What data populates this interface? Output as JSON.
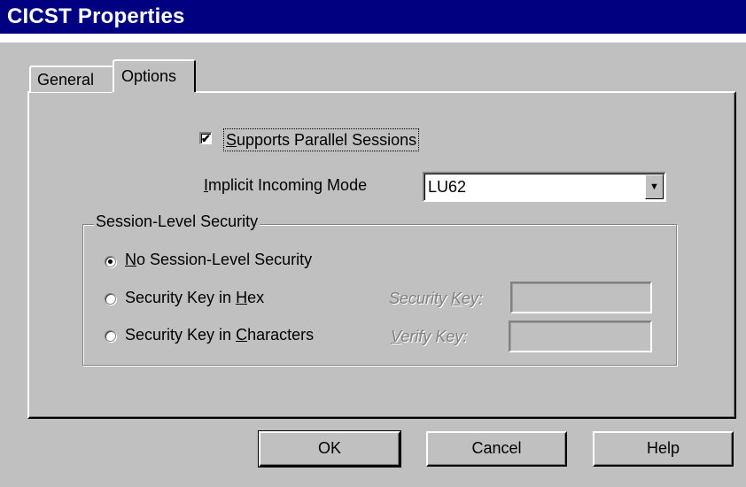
{
  "window": {
    "title": "CICST Properties"
  },
  "tabs": [
    {
      "label": "General",
      "selected": false
    },
    {
      "label": "Options",
      "selected": true
    }
  ],
  "options": {
    "parallel_sessions": {
      "label_prefix": "",
      "label_accel": "S",
      "label_rest": "upports Parallel Sessions",
      "checked": true,
      "check_glyph": "✔"
    },
    "incoming_mode": {
      "label_accel": "I",
      "label_rest": "mplicit Incoming Mode",
      "value": "LU62",
      "arrow_glyph": "▼"
    }
  },
  "security": {
    "legend": "Session-Level Security",
    "radios": [
      {
        "pre": "",
        "accel": "N",
        "post": "o Session-Level Security",
        "selected": true
      },
      {
        "pre": "Security Key in ",
        "accel": "H",
        "post": "ex",
        "selected": false
      },
      {
        "pre": "Security Key in ",
        "accel": "C",
        "post": "haracters",
        "selected": false
      }
    ],
    "security_key": {
      "pre": "Security ",
      "accel": "K",
      "post": "ey:",
      "value": ""
    },
    "verify_key": {
      "pre": "",
      "accel": "V",
      "post": "erify Key:",
      "value": ""
    }
  },
  "buttons": {
    "ok": "OK",
    "cancel": "Cancel",
    "help": "Help"
  },
  "colors": {
    "titlebar": "#000080",
    "face": "#c0c0c0",
    "disabled_text": "#808080"
  }
}
